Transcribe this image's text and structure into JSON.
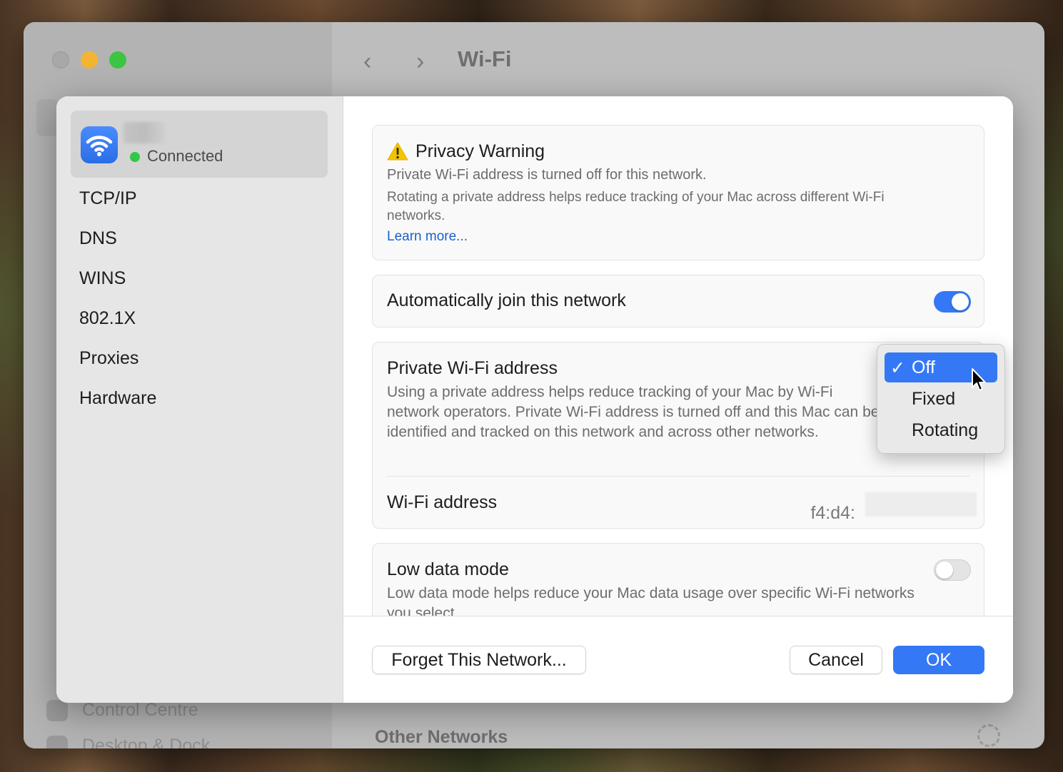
{
  "background_window": {
    "title": "Wi-Fi",
    "back_glyph": "‹",
    "forward_glyph": "›",
    "sidebar_items": [
      "Control Centre",
      "Desktop & Dock"
    ],
    "other_networks_label": "Other Networks"
  },
  "sheet": {
    "network": {
      "status": "Connected",
      "status_color": "#30c848",
      "icon": "wifi-icon"
    },
    "sidebar_links": [
      "TCP/IP",
      "DNS",
      "WINS",
      "802.1X",
      "Proxies",
      "Hardware"
    ],
    "privacy_warning": {
      "title": "Privacy Warning",
      "line1": "Private Wi-Fi address is turned off for this network.",
      "line2": "Rotating a private address helps reduce tracking of your Mac across different Wi-Fi networks.",
      "link": "Learn more..."
    },
    "auto_join": {
      "label": "Automatically join this network",
      "enabled": true
    },
    "private_address": {
      "label": "Private Wi-Fi address",
      "description": "Using a private address helps reduce tracking of your Mac by Wi-Fi network operators. Private Wi-Fi address is turned off and this Mac can be identified and tracked on this network and across other networks.",
      "options": [
        "Off",
        "Fixed",
        "Rotating"
      ],
      "selected": "Off",
      "check_glyph": "✓"
    },
    "wifi_address": {
      "label": "Wi-Fi address",
      "value": "f4:d4:"
    },
    "low_data_mode": {
      "label": "Low data mode",
      "description": "Low data mode helps reduce your Mac data usage over specific Wi-Fi networks you select",
      "enabled": false
    },
    "buttons": {
      "forget": "Forget This Network...",
      "cancel": "Cancel",
      "ok": "OK"
    },
    "accent_color": "#3478f6"
  }
}
